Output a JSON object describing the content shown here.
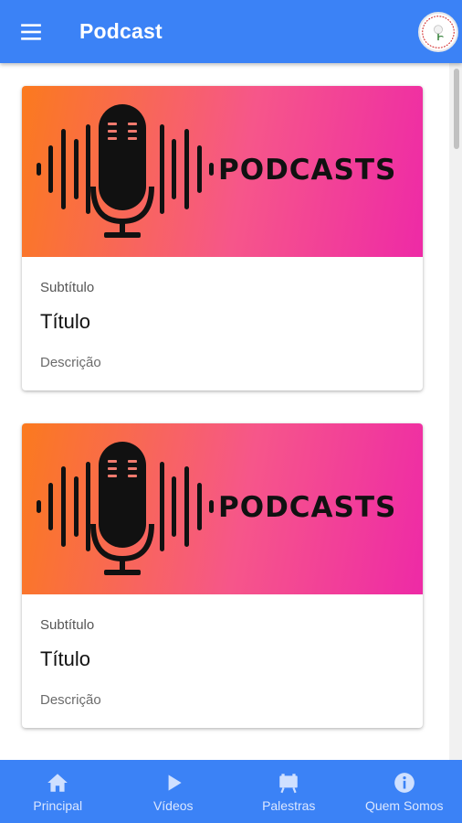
{
  "appbar": {
    "title": "Podcast",
    "menu_icon": "menu-icon",
    "logo_icon": "app-logo"
  },
  "cards": [
    {
      "banner_text": "PODCASTS",
      "subtitle": "Subtítulo",
      "title": "Título",
      "description": "Descrição"
    },
    {
      "banner_text": "PODCASTS",
      "subtitle": "Subtítulo",
      "title": "Título",
      "description": "Descrição"
    }
  ],
  "bottom_nav": {
    "items": [
      {
        "label": "Principal",
        "icon": "home-icon"
      },
      {
        "label": "Vídeos",
        "icon": "play-icon"
      },
      {
        "label": "Palestras",
        "icon": "easel-icon"
      },
      {
        "label": "Quem Somos",
        "icon": "info-icon"
      }
    ]
  },
  "colors": {
    "primary": "#3b82f6",
    "gradient_start": "#fb7a1e",
    "gradient_end": "#ee2aa6"
  }
}
